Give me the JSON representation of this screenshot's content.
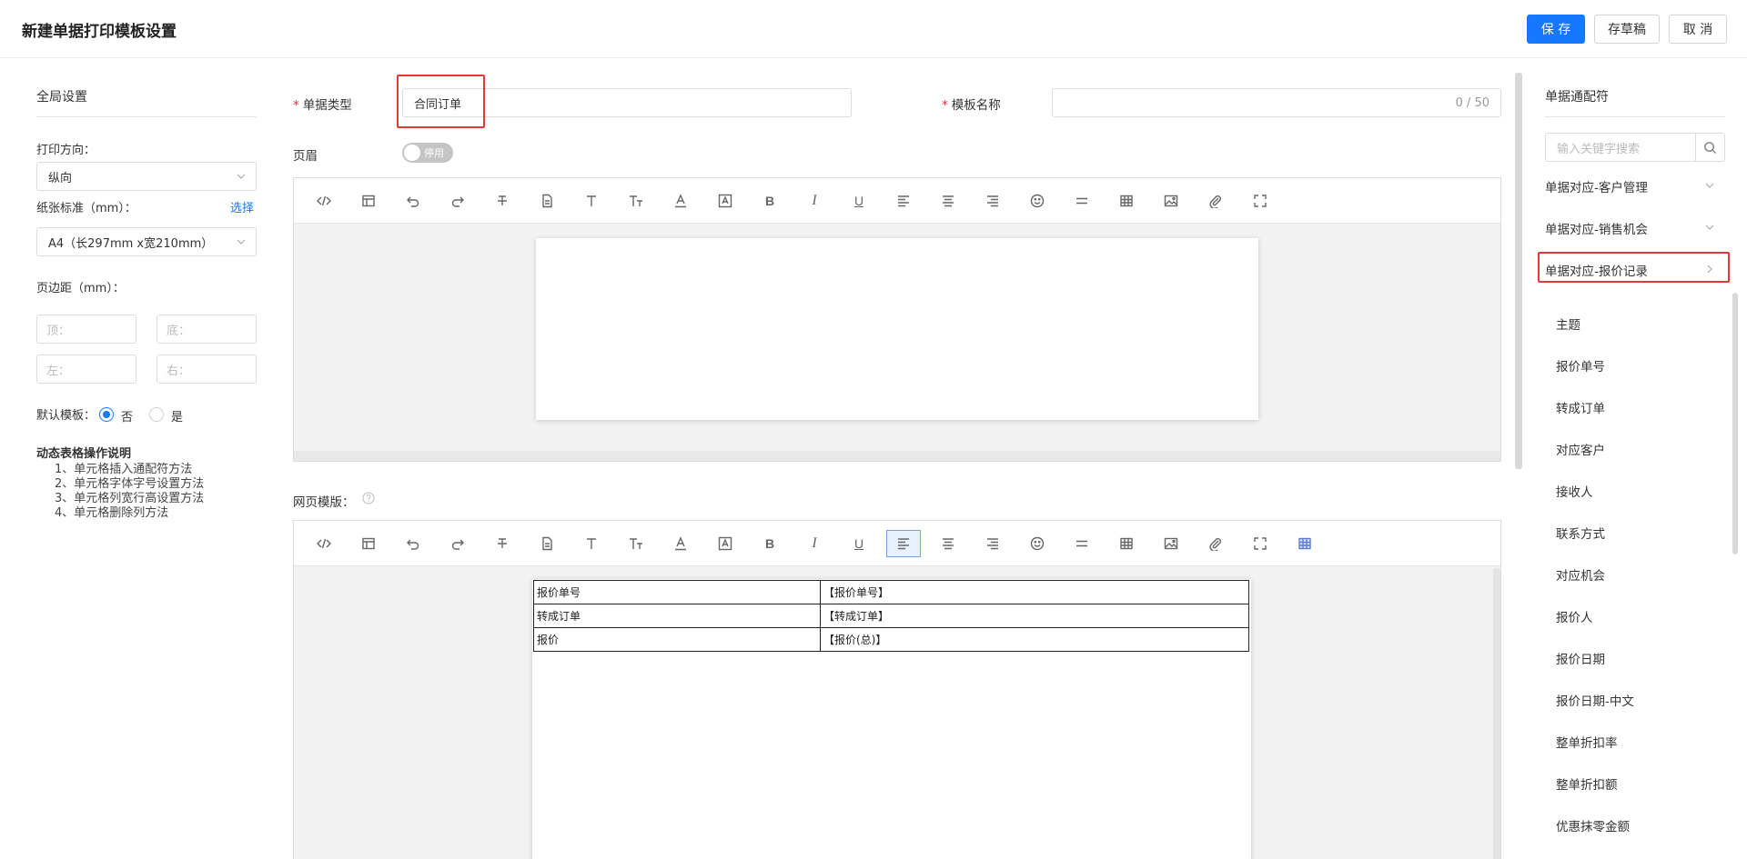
{
  "header": {
    "title": "新建单据打印模板设置",
    "save_label": "保 存",
    "draft_label": "存草稿",
    "cancel_label": "取 消"
  },
  "global": {
    "section_title": "全局设置",
    "orientation_label": "打印方向：",
    "orientation_value": "纵向",
    "paper_label": "纸张标准（mm）：",
    "paper_choose": "选择",
    "paper_value": "A4（长297mm x宽210mm）",
    "margin_label": "页边距（mm）：",
    "margin_top_ph": "顶：",
    "margin_bottom_ph": "底：",
    "margin_left_ph": "左：",
    "margin_right_ph": "右：",
    "default_label": "默认模板：",
    "default_no": "否",
    "default_yes": "是",
    "help_title": "动态表格操作说明",
    "help_items": [
      "1、单元格插入通配符方法",
      "2、单元格字体字号设置方法",
      "3、单元格列宽行高设置方法",
      "4、单元格删除列方法"
    ]
  },
  "form": {
    "doc_type_label": "单据类型",
    "doc_type_value": "合同订单",
    "template_name_label": "模板名称",
    "template_name_count": "0 / 50",
    "header_label": "页眉",
    "header_toggle_text": "停用",
    "web_template_label": "网页模版：",
    "help_icon": "question-circle-icon"
  },
  "template_table": [
    [
      "报价单号",
      "【报价单号】"
    ],
    [
      "转成订单",
      "【转成订单】"
    ],
    [
      "报价",
      "【报价(总)】"
    ]
  ],
  "wildcards": {
    "section_title": "单据通配符",
    "search_placeholder": "输入关键字搜索",
    "groups": [
      "单据对应-客户管理",
      "单据对应-销售机会",
      "单据对应-报价记录"
    ],
    "items": [
      "主题",
      "报价单号",
      "转成订单",
      "对应客户",
      "接收人",
      "联系方式",
      "对应机会",
      "报价人",
      "报价日期",
      "报价日期-中文",
      "整单折扣率",
      "整单折扣额",
      "优惠抹零金额"
    ]
  },
  "colors": {
    "primary": "#1677ff",
    "highlight": "#e53935",
    "required": "#f5222d"
  }
}
